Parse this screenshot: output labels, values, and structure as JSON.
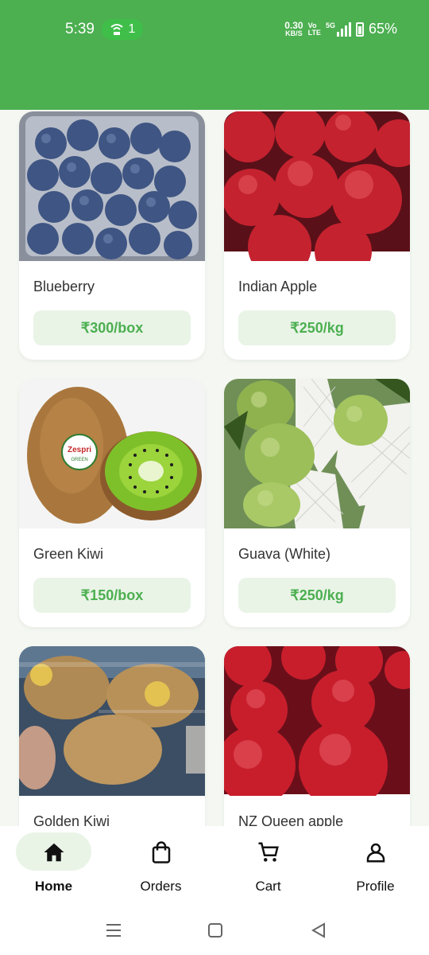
{
  "status_bar": {
    "time": "5:39",
    "hotspot_count": "1",
    "net_speed_value": "0.30",
    "net_speed_unit": "KB/S",
    "volte_line1": "Vo",
    "volte_line2": "LTE",
    "signal_label": "5G",
    "battery": "65%"
  },
  "products": [
    {
      "name": "Blueberry",
      "price": "₹300/box"
    },
    {
      "name": "Indian Apple",
      "price": "₹250/kg"
    },
    {
      "name": "Green Kiwi",
      "price": "₹150/box"
    },
    {
      "name": "Guava (White)",
      "price": "₹250/kg"
    },
    {
      "name": "Golden Kiwi",
      "price": ""
    },
    {
      "name": "NZ Queen apple",
      "price": ""
    }
  ],
  "kiwi_brand": "Zespri",
  "kiwi_brand_sub": "GREEN",
  "bottom_nav": {
    "items": [
      {
        "label": "Home",
        "icon": "home-icon",
        "active": true
      },
      {
        "label": "Orders",
        "icon": "shopping-bag-icon"
      },
      {
        "label": "Cart",
        "icon": "cart-icon"
      },
      {
        "label": "Profile",
        "icon": "person-icon"
      }
    ]
  },
  "colors": {
    "primary": "#4caf50",
    "price_bg": "#e9f4e7"
  }
}
